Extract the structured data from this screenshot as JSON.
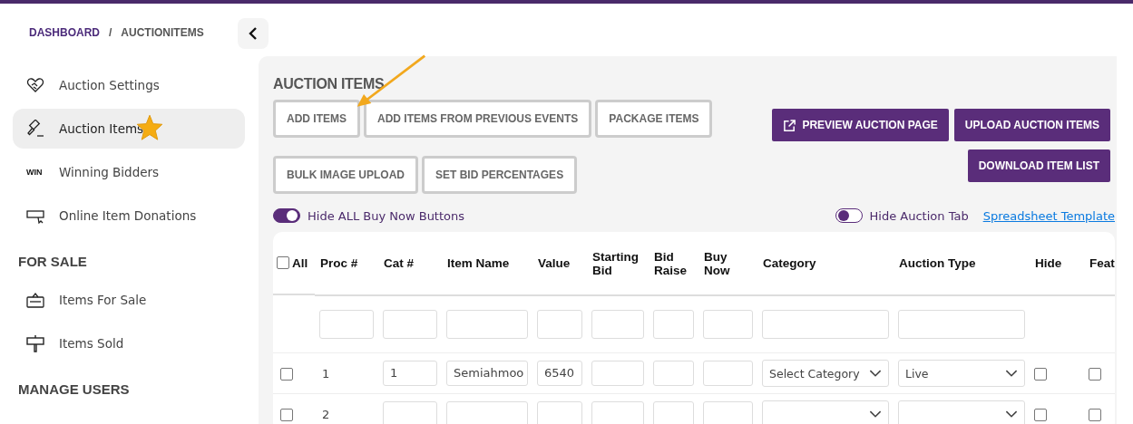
{
  "breadcrumb": {
    "items": [
      "DASHBOARD",
      "AUCTIONITEMS"
    ],
    "separator": "/"
  },
  "sidebar": {
    "sections": [
      {
        "items": [
          {
            "label": "Auction Settings",
            "selected": false
          },
          {
            "label": "Auction Items",
            "selected": true
          },
          {
            "label": "Winning Bidders",
            "selected": false,
            "icon_text": "WIN"
          },
          {
            "label": "Online Item Donations",
            "selected": false
          }
        ]
      },
      {
        "heading": "FOR SALE",
        "items": [
          {
            "label": "Items For Sale",
            "selected": false
          },
          {
            "label": "Items Sold",
            "selected": false
          }
        ]
      },
      {
        "heading": "MANAGE USERS"
      }
    ]
  },
  "page": {
    "title": "AUCTION ITEMS",
    "actions": [
      [
        "ADD ITEMS",
        "ADD ITEMS FROM PREVIOUS EVENTS",
        "PACKAGE ITEMS"
      ],
      [
        "BULK IMAGE UPLOAD",
        "SET BID PERCENTAGES"
      ]
    ],
    "primary_actions": [
      [
        "PREVIEW AUCTION PAGE",
        "UPLOAD AUCTION ITEMS"
      ],
      [
        "DOWNLOAD ITEM LIST"
      ]
    ],
    "toggles": [
      {
        "label": "Hide ALL Buy Now Buttons",
        "on": true
      },
      {
        "label": "Hide Auction Tab",
        "on": false
      }
    ],
    "link": "Spreadsheet Template"
  },
  "table": {
    "select_all": {
      "label": "All",
      "checked": false
    },
    "columns": [
      "Proc #",
      "Cat #",
      "Item Name",
      "Value",
      "Starting Bid",
      "Bid Raise",
      "Buy Now",
      "Category",
      "Auction Type",
      "Hide",
      "Feat"
    ],
    "rows": [
      {
        "checked": false,
        "proc": "1",
        "cat": "1",
        "item_name": "Semiahmoo",
        "value": "6540",
        "category": "Select Category",
        "auction_type": "Live",
        "hide": false,
        "feat": false
      },
      {
        "checked": false,
        "proc": "2",
        "hide": false,
        "feat": false
      }
    ]
  }
}
